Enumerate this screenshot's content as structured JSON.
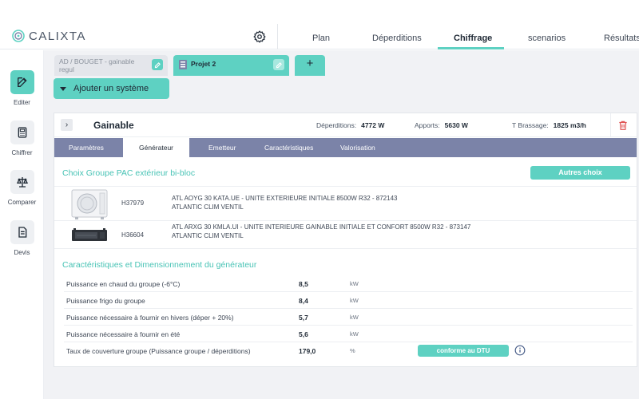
{
  "app": {
    "logo_text": "CALIXTA"
  },
  "nav": {
    "tabs": [
      "Plan",
      "Déperditions",
      "Chiffrage",
      "scenarios",
      "Résultats"
    ],
    "active": "Chiffrage"
  },
  "sidebar": {
    "items": [
      {
        "label": "Editer",
        "icon": "edit-icon"
      },
      {
        "label": "Chiffrer",
        "icon": "calculator-icon"
      },
      {
        "label": "Comparer",
        "icon": "balance-icon"
      },
      {
        "label": "Devis",
        "icon": "document-icon"
      }
    ]
  },
  "project_tabs": {
    "tab1_line1": "AD / BOUGET - gainable",
    "tab1_line2": "regul",
    "tab2": "Projet 2",
    "add": "+"
  },
  "add_system_label": "Ajouter un système",
  "system": {
    "title": "Gainable",
    "deperditions_label": "Déperditions:",
    "deperditions_value": "4772 W",
    "apports_label": "Apports:",
    "apports_value": "5630 W",
    "brassage_label": "T Brassage:",
    "brassage_value": "1825 m3/h"
  },
  "sub_tabs": [
    "Paramètres",
    "Générateur",
    "Emetteur",
    "Caractéristiques",
    "Valorisation"
  ],
  "choice": {
    "title": "Choix Groupe PAC extérieur bi-bloc",
    "other_button": "Autres choix",
    "products": [
      {
        "ref": "H37979",
        "desc1": "ATL AOYG 30 KATA.UE - UNITE EXTERIEURE INITIALE 8500W R32 - 872143",
        "desc2": "ATLANTIC CLIM VENTIL"
      },
      {
        "ref": "H36604",
        "desc1": "ATL ARXG 30 KMLA.UI - UNITE INTERIEURE GAINABLE INITIALE ET CONFORT 8500W R32 - 873147",
        "desc2": "ATLANTIC CLIM VENTIL"
      }
    ]
  },
  "characteristics": {
    "title": "Caractéristiques et Dimensionnement du générateur",
    "rows": [
      {
        "label": "Puissance en chaud du groupe (-6°C)",
        "value": "8,5",
        "unit": "kW"
      },
      {
        "label": "Puissance frigo du groupe",
        "value": "8,4",
        "unit": "kW"
      },
      {
        "label": "Puissance nécessaire à fournir en hivers (déper + 20%)",
        "value": "5,7",
        "unit": "kW"
      },
      {
        "label": "Puissance nécessaire à fournir en été",
        "value": "5,6",
        "unit": "kW"
      },
      {
        "label": "Taux de couverture groupe (Puissance groupe / déperditions)",
        "value": "179,0",
        "unit": "%"
      }
    ],
    "dtu_badge": "conforme au DTU"
  },
  "colors": {
    "accent": "#5ed1c2",
    "subnav": "#7b83a8",
    "title_teal": "#48c3b5",
    "danger": "#e05555"
  }
}
